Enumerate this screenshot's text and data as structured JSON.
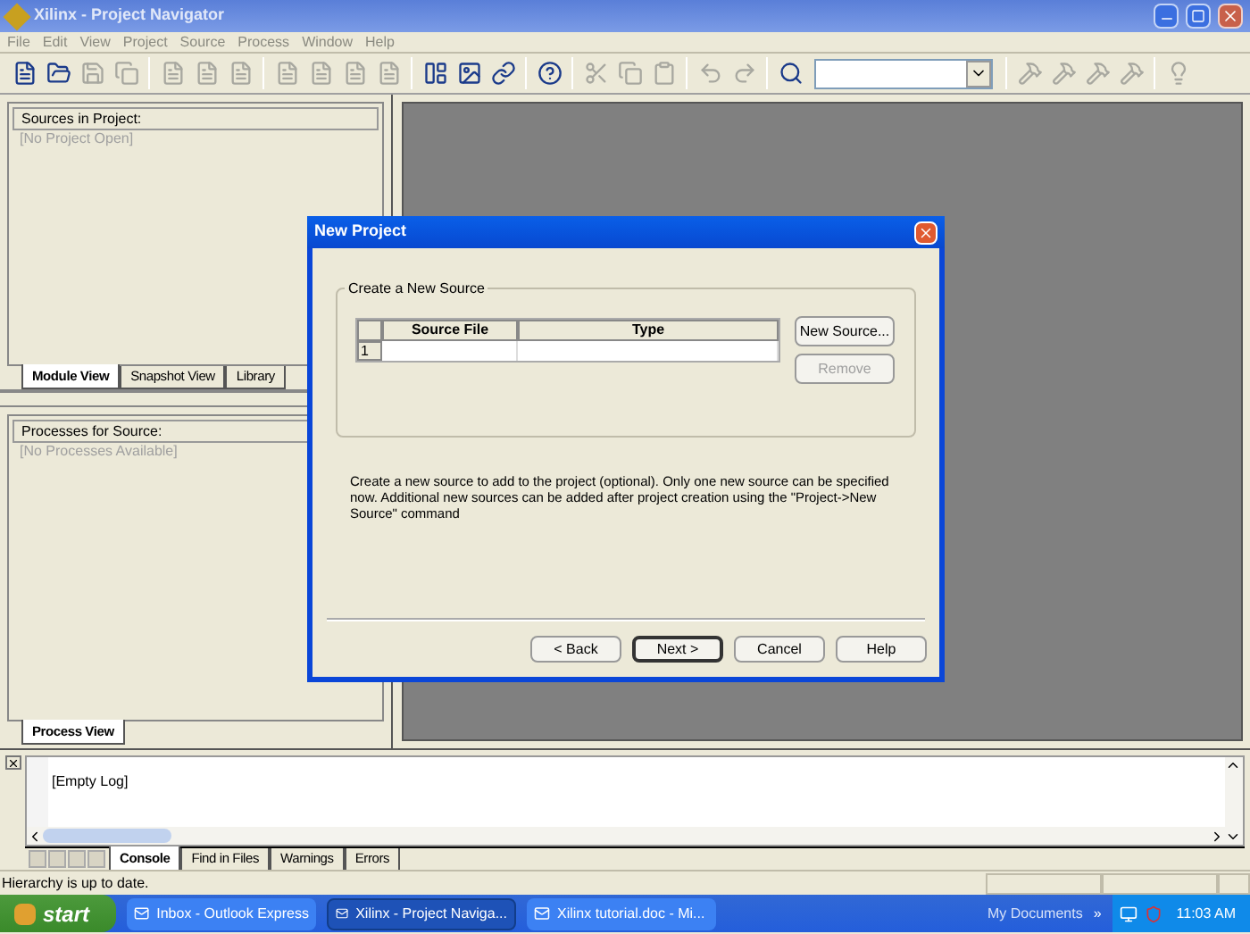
{
  "window": {
    "title": "Xilinx - Project Navigator"
  },
  "menu": [
    "File",
    "Edit",
    "View",
    "Project",
    "Source",
    "Process",
    "Window",
    "Help"
  ],
  "toolbar": [
    {
      "kind": "new",
      "disabled": false
    },
    {
      "kind": "open",
      "disabled": false
    },
    {
      "kind": "save",
      "disabled": true
    },
    {
      "kind": "saveall",
      "disabled": true
    },
    {
      "kind": "sep"
    },
    {
      "kind": "doc",
      "disabled": true
    },
    {
      "kind": "doc",
      "disabled": true
    },
    {
      "kind": "doc",
      "disabled": true
    },
    {
      "kind": "sep"
    },
    {
      "kind": "doc",
      "disabled": true
    },
    {
      "kind": "doc",
      "disabled": true
    },
    {
      "kind": "doc",
      "disabled": true
    },
    {
      "kind": "doc",
      "disabled": true
    },
    {
      "kind": "sep"
    },
    {
      "kind": "panel",
      "disabled": false
    },
    {
      "kind": "image",
      "disabled": false
    },
    {
      "kind": "link",
      "disabled": false
    },
    {
      "kind": "sep"
    },
    {
      "kind": "help",
      "disabled": false
    },
    {
      "kind": "sep"
    },
    {
      "kind": "cut",
      "disabled": true
    },
    {
      "kind": "copy",
      "disabled": true
    },
    {
      "kind": "paste",
      "disabled": true
    },
    {
      "kind": "sep"
    },
    {
      "kind": "undo",
      "disabled": true
    },
    {
      "kind": "redo",
      "disabled": true
    },
    {
      "kind": "sep"
    },
    {
      "kind": "find",
      "disabled": false
    },
    {
      "kind": "combo"
    },
    {
      "kind": "sep"
    },
    {
      "kind": "hammer",
      "disabled": true
    },
    {
      "kind": "hammer",
      "disabled": true
    },
    {
      "kind": "hammer",
      "disabled": true
    },
    {
      "kind": "hammer",
      "disabled": true
    },
    {
      "kind": "sep"
    },
    {
      "kind": "bulb",
      "disabled": true
    }
  ],
  "sources_panel": {
    "title": "Sources in Project:",
    "placeholder": "[No Project Open]",
    "tabs": [
      {
        "label": "Module View",
        "selected": true
      },
      {
        "label": "Snapshot View",
        "selected": false
      },
      {
        "label": "Library",
        "selected": false
      }
    ]
  },
  "processes_panel": {
    "title": "Processes for Source:",
    "placeholder": "[No Processes Available]",
    "tabs": [
      {
        "label": "Process View",
        "selected": true
      }
    ]
  },
  "dialog": {
    "title": "New Project",
    "group": "Create a New Source",
    "table": {
      "columns": [
        "Source File",
        "Type"
      ],
      "rows": [
        {
          "number": "1",
          "cells": [
            "",
            ""
          ]
        }
      ]
    },
    "side_buttons": [
      {
        "label": "New Source...",
        "disabled": false
      },
      {
        "label": "Remove",
        "disabled": true
      }
    ],
    "description": "Create a new source to add to the project (optional). Only one new source can be specified now. Additional new sources can be added after project creation using the \"Project->New Source\" command",
    "buttons": [
      {
        "label": "< Back",
        "default": false
      },
      {
        "label": "Next >",
        "default": true
      },
      {
        "label": "Cancel",
        "default": false
      },
      {
        "label": "Help",
        "default": false
      }
    ]
  },
  "log": {
    "text": "[Empty Log]",
    "tabs": [
      {
        "label": "Console",
        "selected": true
      },
      {
        "label": "Find in Files",
        "selected": false
      },
      {
        "label": "Warnings",
        "selected": false
      },
      {
        "label": "Errors",
        "selected": false
      }
    ]
  },
  "status_bar": "Hierarchy is up to date.",
  "taskbar": {
    "start": "start",
    "tasks": [
      {
        "label": "Inbox - Outlook Express",
        "selected": false
      },
      {
        "label": "Xilinx - Project Naviga...",
        "selected": true
      },
      {
        "label": "Xilinx tutorial.doc - Mi...",
        "selected": false
      }
    ],
    "tray_label": "My Documents",
    "chevron": "»",
    "clock": "11:03 AM"
  }
}
